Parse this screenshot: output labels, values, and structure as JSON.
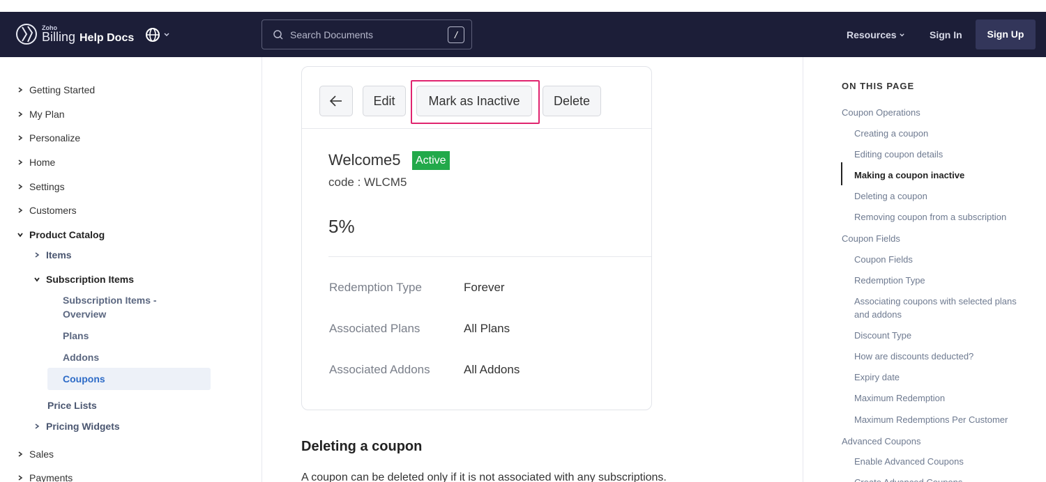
{
  "header": {
    "logo_small": "Zoho",
    "logo_product": "Billing",
    "logo_suffix": "Help Docs",
    "search_placeholder": "Search Documents",
    "search_shortcut": "/",
    "nav_resources": "Resources",
    "nav_signin": "Sign In",
    "nav_signup": "Sign Up"
  },
  "sidebar": {
    "items": [
      "Getting Started",
      "My Plan",
      "Personalize",
      "Home",
      "Settings",
      "Customers",
      "Product Catalog",
      "Items",
      "Subscription Items",
      "Subscription Items - Overview",
      "Plans",
      "Addons",
      "Coupons",
      "Price Lists",
      "Pricing Widgets",
      "Sales",
      "Payments"
    ]
  },
  "card": {
    "buttons": {
      "edit": "Edit",
      "mark_inactive": "Mark as Inactive",
      "delete": "Delete"
    },
    "coupon_name": "Welcome5",
    "status": "Active",
    "code": "code : WLCM5",
    "discount": "5%",
    "details": [
      {
        "label": "Redemption Type",
        "value": "Forever"
      },
      {
        "label": "Associated Plans",
        "value": "All Plans"
      },
      {
        "label": "Associated Addons",
        "value": "All Addons"
      }
    ]
  },
  "content": {
    "section_title": "Deleting a coupon",
    "section_body": "A coupon can be deleted only if it is not associated with any subscriptions."
  },
  "toc": {
    "title": "ON THIS PAGE",
    "entries": [
      "Coupon Operations",
      "Creating a coupon",
      "Editing coupon details",
      "Making a coupon inactive",
      "Deleting a coupon",
      "Removing coupon from a subscription",
      "Coupon Fields",
      "Coupon Fields",
      "Redemption Type",
      "Associating coupons with selected plans and addons",
      "Discount Type",
      "How are discounts deducted?",
      "Expiry date",
      "Maximum Redemption",
      "Maximum Redemptions Per Customer",
      "Advanced Coupons",
      "Enable Advanced Coupons",
      "Create Advanced Coupons"
    ]
  },
  "colors": {
    "header_bg": "#1c1e38",
    "highlight": "#e0246f",
    "badge": "#22a94a",
    "link_active": "#2d6bc7"
  }
}
